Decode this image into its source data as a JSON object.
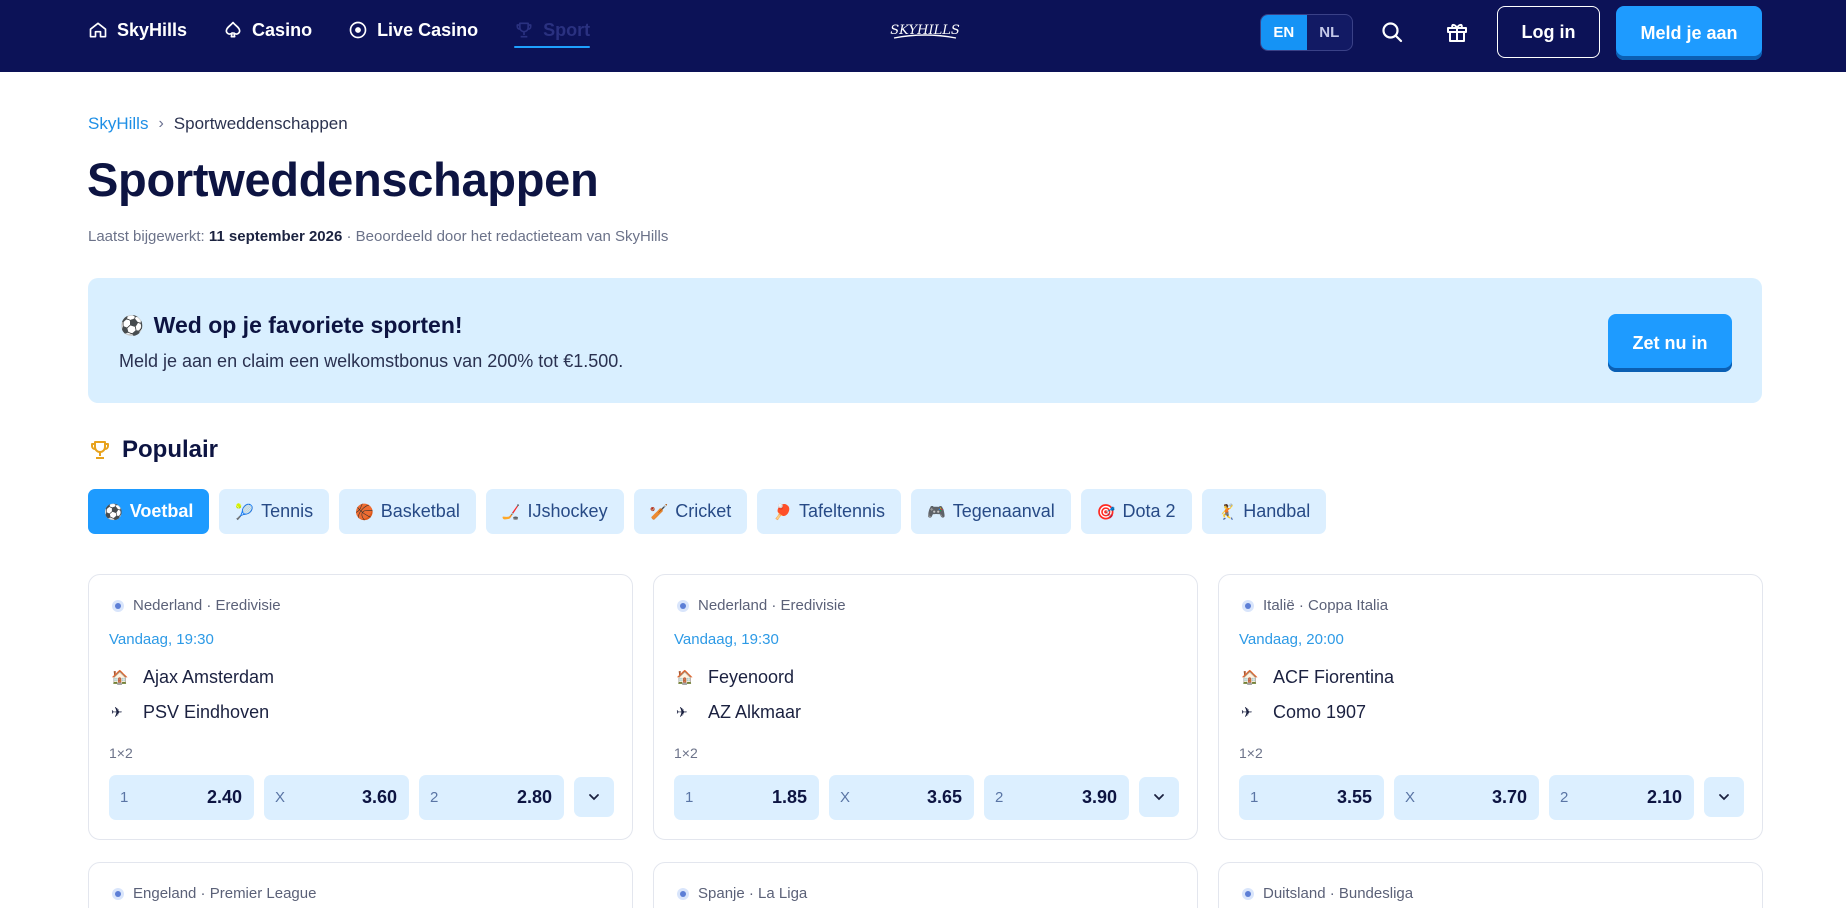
{
  "header": {
    "nav": [
      {
        "label": "SkyHills",
        "icon": "home-icon"
      },
      {
        "label": "Casino",
        "icon": "spade-icon"
      },
      {
        "label": "Live Casino",
        "icon": "live-icon"
      },
      {
        "label": "Sport",
        "icon": "trophy-icon",
        "active": true
      }
    ],
    "logo_text": "SKYHILLS",
    "languages": [
      "EN",
      "NL"
    ],
    "active_language": "EN",
    "login_label": "Log in",
    "signup_label": "Meld je aan"
  },
  "breadcrumb": {
    "home": "SkyHills",
    "separator": "›",
    "current": "Sportweddenschappen"
  },
  "page": {
    "title": "Sportweddenschappen",
    "updated_prefix": "Laatst bijgewerkt:",
    "updated_date": "11 september 2026",
    "reviewed": "· Beoordeeld door het redactieteam van SkyHills"
  },
  "promo": {
    "title": "Wed op je favoriete sporten!",
    "text": "Meld je aan en claim een welkomstbonus van 200% tot €1.500.",
    "button": "Zet nu in"
  },
  "popular": {
    "title": "Populair",
    "tabs": [
      {
        "label": "Voetbal",
        "emoji": "⚽",
        "active": true
      },
      {
        "label": "Tennis",
        "emoji": "🎾"
      },
      {
        "label": "Basketbal",
        "emoji": "🏀"
      },
      {
        "label": "IJshockey",
        "emoji": "🏒"
      },
      {
        "label": "Cricket",
        "emoji": "🏏"
      },
      {
        "label": "Tafeltennis",
        "emoji": "🏓"
      },
      {
        "label": "Tegenaanval",
        "emoji": "🎮"
      },
      {
        "label": "Dota 2",
        "emoji": "🎯"
      },
      {
        "label": "Handbal",
        "emoji": "🤾"
      }
    ]
  },
  "matches": [
    {
      "league": "Nederland · Eredivisie",
      "time": "Vandaag, 19:30",
      "home": "Ajax Amsterdam",
      "away": "PSV Eindhoven",
      "market": "1×2",
      "odds": [
        {
          "label": "1",
          "value": "2.40"
        },
        {
          "label": "X",
          "value": "3.60"
        },
        {
          "label": "2",
          "value": "2.80"
        }
      ]
    },
    {
      "league": "Nederland · Eredivisie",
      "time": "Vandaag, 19:30",
      "home": "Feyenoord",
      "away": "AZ Alkmaar",
      "market": "1×2",
      "odds": [
        {
          "label": "1",
          "value": "1.85"
        },
        {
          "label": "X",
          "value": "3.65"
        },
        {
          "label": "2",
          "value": "3.90"
        }
      ]
    },
    {
      "league": "Italië · Coppa Italia",
      "time": "Vandaag, 20:00",
      "home": "ACF Fiorentina",
      "away": "Como 1907",
      "market": "1×2",
      "odds": [
        {
          "label": "1",
          "value": "3.55"
        },
        {
          "label": "X",
          "value": "3.70"
        },
        {
          "label": "2",
          "value": "2.10"
        }
      ]
    },
    {
      "league": "Engeland · Premier League"
    },
    {
      "league": "Spanje · La Liga"
    },
    {
      "league": "Duitsland · Bundesliga"
    }
  ],
  "colors": {
    "header_bg": "#0c1257",
    "accent": "#1e9bff",
    "chip_bg": "#dcefff",
    "promo_bg": "#d9efff"
  }
}
